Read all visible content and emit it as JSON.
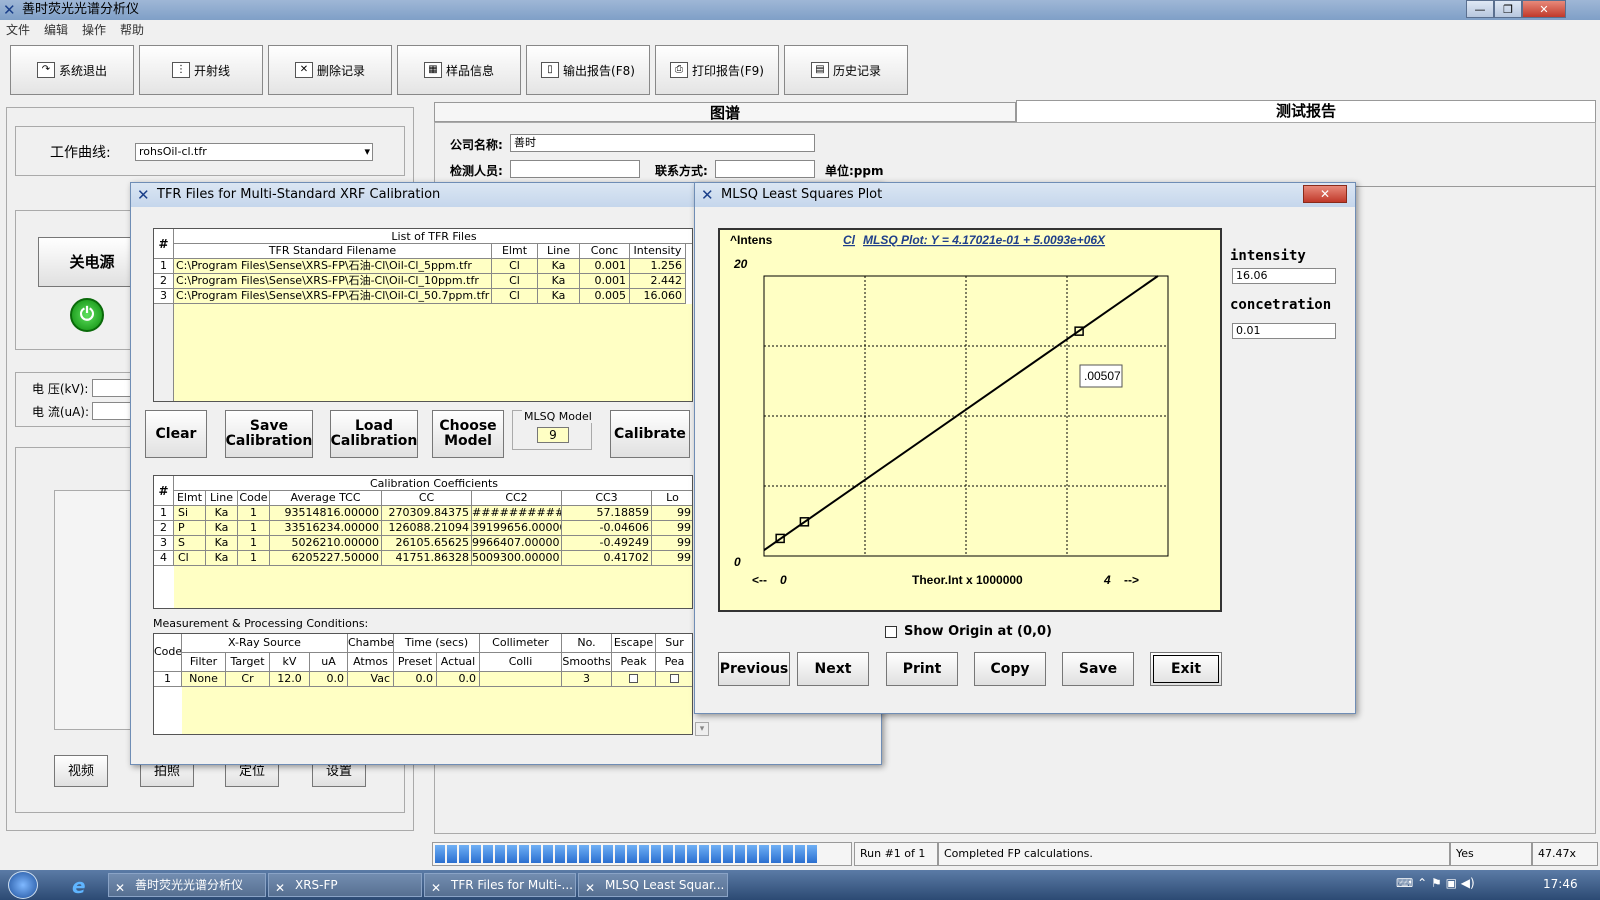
{
  "app": {
    "title": "善时荧光光谱分析仪",
    "min": "0",
    "max": "1",
    "close": "r"
  },
  "menu": [
    "文件",
    "编辑",
    "操作",
    "帮助"
  ],
  "toolbar": [
    {
      "label": "系统退出",
      "icon": "exit-icon",
      "glyph": "↷"
    },
    {
      "label": "开射线",
      "icon": "xray-icon",
      "glyph": "⋮"
    },
    {
      "label": "删除记录",
      "icon": "delete-icon",
      "glyph": "✕"
    },
    {
      "label": "样品信息",
      "icon": "sample-info-icon",
      "glyph": "▦"
    },
    {
      "label": "输出报告(F8)",
      "icon": "export-icon",
      "glyph": "▯"
    },
    {
      "label": "打印报告(F9)",
      "icon": "print-icon",
      "glyph": "⎙"
    },
    {
      "label": "历史记录",
      "icon": "history-icon",
      "glyph": "▤"
    }
  ],
  "left": {
    "curve_label": "工作曲线:",
    "curve_value": "rohsOil-cl.tfr",
    "power_btn": "关电源",
    "voltage_label": "电  压(kV):",
    "current_label": "电  流(uA):",
    "bottom_buttons": [
      "视频",
      "拍照",
      "定位",
      "设置"
    ]
  },
  "tabs": {
    "spectrum": "图谱",
    "report": "测试报告"
  },
  "report": {
    "company_label": "公司名称:",
    "company_value": "善时",
    "inspector_label": "检测人员:",
    "contact_label": "联系方式:",
    "unit_label": "单位:ppm"
  },
  "tfr": {
    "title": "TFR Files for Multi-Standard XRF Calibration",
    "list_title": "List of TFR Files",
    "hash": "#",
    "columns": [
      "TFR Standard Filename",
      "Elmt",
      "Line",
      "Conc",
      "Intensity"
    ],
    "rows": [
      [
        "1",
        "C:\\Program Files\\Sense\\XRS-FP\\石油-Cl\\Oil-Cl_5ppm.tfr",
        "Cl",
        "Ka",
        "0.001",
        "1.256"
      ],
      [
        "2",
        "C:\\Program Files\\Sense\\XRS-FP\\石油-Cl\\Oil-Cl_10ppm.tfr",
        "Cl",
        "Ka",
        "0.001",
        "2.442"
      ],
      [
        "3",
        "C:\\Program Files\\Sense\\XRS-FP\\石油-Cl\\Oil-Cl_50.7ppm.tfr",
        "Cl",
        "Ka",
        "0.005",
        "16.060"
      ]
    ],
    "btn_clear": "Clear",
    "btn_save": "Save Calibration",
    "btn_load": "Load Calibration",
    "btn_choose": "Choose Model",
    "mlsq_label": "MLSQ Model",
    "mlsq_value": "9",
    "btn_calibrate": "Calibrate",
    "coef_title": "Calibration Coefficients",
    "coef_columns": [
      "Elmt",
      "Line",
      "Code",
      "Average TCC",
      "CC",
      "CC2",
      "CC3",
      "Lo"
    ],
    "coef_rows": [
      [
        "1",
        "Si",
        "Ka",
        "1",
        "93514816.00000",
        "270309.84375",
        "############",
        "57.18859",
        "99"
      ],
      [
        "2",
        "P",
        "Ka",
        "1",
        "33516234.00000",
        "126088.21094",
        "39199656.00000",
        "-0.04606",
        "99"
      ],
      [
        "3",
        "S",
        "Ka",
        "1",
        "5026210.00000",
        "26105.65625",
        "9966407.00000",
        "-0.49249",
        "99"
      ],
      [
        "4",
        "Cl",
        "Ka",
        "1",
        "6205227.50000",
        "41751.86328",
        "5009300.00000",
        "0.41702",
        "99"
      ]
    ],
    "meas_title": "Measurement & Processing Conditions:",
    "meas_h1": [
      "Code",
      "X-Ray Source",
      "Chamber",
      "Time (secs)",
      "Collimeter",
      "No.",
      "Escape",
      "Sur"
    ],
    "meas_h2": [
      "Filter",
      "Target",
      "kV",
      "uA",
      "Atmos",
      "Preset",
      "Actual",
      "Colli",
      "Smooths",
      "Peak",
      "Pea"
    ],
    "meas_row": [
      "1",
      "None",
      "Cr",
      "12.0",
      "0.0",
      "Vac",
      "0.0",
      "0.0",
      "",
      "3"
    ]
  },
  "mlsq": {
    "title": "MLSQ Least Squares Plot",
    "close": "✕",
    "plot_title_el": "Cl",
    "plot_title": "MLSQ Plot:  Y = 4.17021e-01 + 5.0093e+06X",
    "intens_label": "^Intens",
    "y_max": "20",
    "y_min": "0",
    "x_left": "<--",
    "x_min": "0",
    "x_label": "Theor.Int x 1000000",
    "x_max": "4",
    "x_right": "-->",
    "tooltip": ".00507",
    "intensity_label": "intensity",
    "intensity_value": "16.06",
    "concentration_label": "concetration",
    "concentration_value": "0.01",
    "show_origin": "Show Origin at (0,0)",
    "buttons": [
      "Previous",
      "Next",
      "Print",
      "Copy",
      "Save",
      "Exit"
    ]
  },
  "chart_data": {
    "type": "scatter",
    "title": "Cl  MLSQ Plot:  Y = 4.17021e-01 + 5.0093e+06X",
    "xlabel": "Theor.Int x 1000000",
    "ylabel": "^Intens",
    "xlim": [
      0,
      4
    ],
    "ylim": [
      0,
      20
    ],
    "grid": true,
    "series": [
      {
        "values": [
          [
            0.16,
            1.256
          ],
          [
            0.4,
            2.442
          ],
          [
            3.12,
            16.06
          ]
        ]
      }
    ],
    "fit_line": [
      [
        0,
        0.417
      ],
      [
        3.9,
        20
      ]
    ]
  },
  "status": {
    "run": "Run #1 of 1",
    "message": "Completed FP calculations.",
    "yes": "Yes",
    "pct": "47.47x",
    "progress": 0.98
  },
  "taskbar": {
    "items": [
      "善时荧光光谱分析仪",
      "XRS-FP",
      "TFR Files for Multi-...",
      "MLSQ Least Squar..."
    ],
    "time": "17:46"
  },
  "colors": {
    "plot_bg": "#ffffc4",
    "grid_yellow": "#ffffc4",
    "accent": "#1f3f8a"
  }
}
